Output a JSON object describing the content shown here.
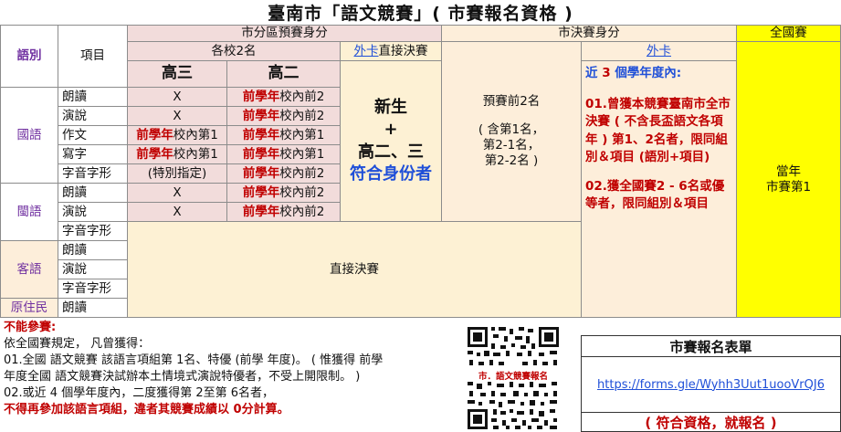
{
  "title": "臺南市「語文競賽」( 市賽報名資格 )",
  "header": {
    "lang": "語別",
    "item": "項目",
    "district": "市分區預賽身分",
    "city_final": "市決賽身分",
    "national": "全國賽",
    "school_top2": "各校2名",
    "wildcard_link": "外卡",
    "direct_final": "直接決賽",
    "wildcard2": "外卡",
    "grade3": "高三",
    "grade2": "高二"
  },
  "rows": [
    {
      "lang": "國語",
      "item": "朗讀",
      "g3": "X",
      "g2_red": "前學年",
      "g2_rest": "校內前2"
    },
    {
      "item": "演說",
      "g3": "X",
      "g2_red": "前學年",
      "g2_rest": "校內前2"
    },
    {
      "item": "作文",
      "g3_red": "前學年",
      "g3_rest": "校內第1",
      "g2_red": "前學年",
      "g2_rest": "校內第1"
    },
    {
      "item": "寫字",
      "g3_red": "前學年",
      "g3_rest": "校內第1",
      "g2_red": "前學年",
      "g2_rest": "校內第1"
    },
    {
      "item": "字音字形",
      "g3": "(特別指定)",
      "g2_red": "前學年",
      "g2_rest": "校內前2"
    },
    {
      "lang": "閩語",
      "item": "朗讀",
      "g3": "X",
      "g2_red": "前學年",
      "g2_rest": "校內前2"
    },
    {
      "item": "演說",
      "g3": "X",
      "g2_red": "前學年",
      "g2_rest": "校內前2"
    },
    {
      "item": "字音字形"
    },
    {
      "lang": "客語",
      "item": "朗讀"
    },
    {
      "item": "演說"
    },
    {
      "item": "字音字形"
    },
    {
      "lang": "原住民",
      "item": "朗讀"
    }
  ],
  "direct": {
    "line1": "新生",
    "plus": "+",
    "line2": "高二、三",
    "line3": "符合身份者"
  },
  "prelim": {
    "top": "預賽前2名",
    "sub1": "( 含第1名，",
    "sub2": "第2-1名，",
    "sub3": "第2-2名 )"
  },
  "direct_final_block": "直接決賽",
  "wildcard_conditions": {
    "intro_a": "近",
    "intro_num": "3",
    "intro_b": "個學年度內:",
    "c1": "01.曾獲本競賽臺南市全市決賽 ( 不含長盃語文各項 年 ) 第1、2名者，限同組別＆項目 (語別+項目)",
    "c2": "02.獲全國賽2 - 6名或優等者，限同組別＆項目"
  },
  "national_cell": {
    "line1": "當年",
    "line2": "市賽第1"
  },
  "notes": {
    "head": "不能參賽:",
    "l1": "依全國賽規定， 凡曾獲得：",
    "l2": "01.全國 語文競賽 該語言項組第 1名、特優 (前學 年度)。 ( 惟獲得 前學",
    "l3": "年度全國 語文競賽決試辦本土情境式演說特優者，不受上開限制。 )",
    "l4": "02.或近 4 個學年度內，二度獲得第 2至第 6名者，",
    "l5": "不得再參加該語言項組，違者其競賽成績以 0分計算。"
  },
  "qr_caption": "市．語文競賽報名",
  "form": {
    "title": "市賽報名表單",
    "link": "https://forms.gle/Wyhh3Uut1uooVrQJ6",
    "note": "( 符合資格，就報名 )"
  }
}
